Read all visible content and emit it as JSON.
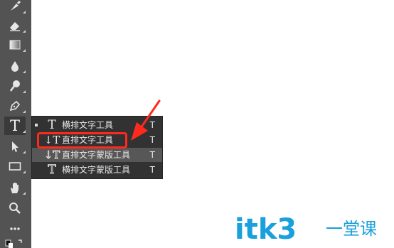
{
  "toolbar": {
    "tools": [
      {
        "icon": "brush-icon"
      },
      {
        "icon": "eraser-icon"
      },
      {
        "icon": "gradient-icon"
      },
      {
        "icon": "blur-drop-icon"
      },
      {
        "icon": "dodge-icon"
      },
      {
        "icon": "pen-icon"
      },
      {
        "icon": "type-icon",
        "glyph": "T",
        "active": true
      },
      {
        "icon": "path-selection-icon"
      },
      {
        "icon": "rectangle-icon"
      },
      {
        "icon": "hand-icon"
      },
      {
        "icon": "zoom-icon"
      },
      {
        "icon": "more-icon"
      }
    ]
  },
  "flyout": {
    "items": [
      {
        "icon": "horizontal-type-icon",
        "glyph": "T",
        "label": "横排文字工具",
        "shortcut": "T",
        "selected": true
      },
      {
        "icon": "vertical-type-icon",
        "glyph": "↓T",
        "label": "直排文字工具",
        "shortcut": "T"
      },
      {
        "icon": "vertical-type-mask-icon",
        "glyph": "↓T",
        "label": "直排文字蒙版工具",
        "shortcut": "T",
        "hover": true
      },
      {
        "icon": "horizontal-type-mask-icon",
        "glyph": "T",
        "label": "横排文字蒙版工具",
        "shortcut": "T"
      }
    ]
  },
  "annotation": {
    "color": "#ff2a1e"
  },
  "watermark": {
    "brand": "itk3",
    "suffix": "一堂课",
    "color": "#1aa0dc"
  }
}
